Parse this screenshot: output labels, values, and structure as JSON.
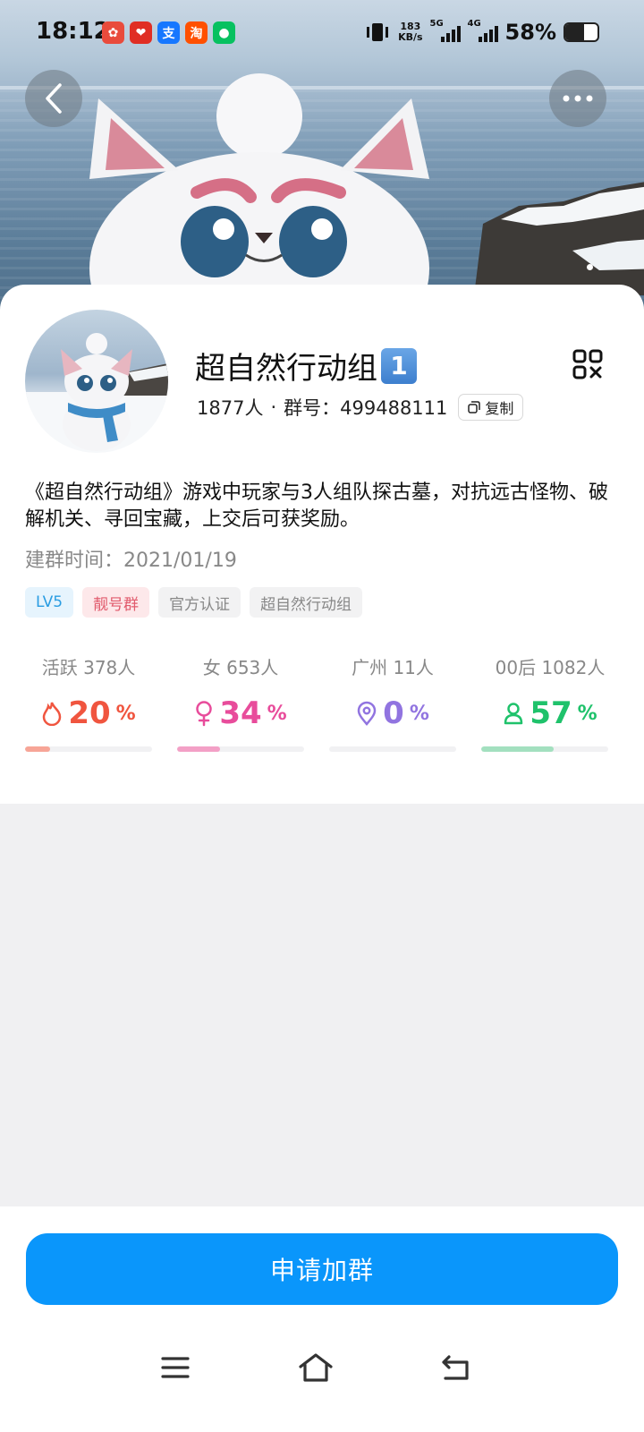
{
  "status_bar": {
    "time": "18:12",
    "net_speed_value": "183",
    "net_speed_unit": "KB/s",
    "signal_1_label": "5G",
    "signal_2_label": "4G",
    "battery_percent": "58%",
    "battery_level": 0.58,
    "app_icons": [
      {
        "name": "baidu-map-icon",
        "glyph": "✿",
        "color": "#e94b3c"
      },
      {
        "name": "pinduoduo-icon",
        "glyph": "❤",
        "color": "#e02e24"
      },
      {
        "name": "alipay-icon",
        "glyph": "支",
        "color": "#1677ff"
      },
      {
        "name": "taobao-icon",
        "glyph": "淘",
        "color": "#ff5000"
      },
      {
        "name": "wechat-icon",
        "glyph": "●",
        "color": "#07c160"
      }
    ]
  },
  "header": {
    "back_icon": "chevron-left-icon",
    "more_icon": "more-horizontal-icon"
  },
  "group": {
    "name": "超自然行动组",
    "name_emoji": "1",
    "member_count": "1877人",
    "separator": "·",
    "group_id_label": "群号：",
    "group_id": "499488111",
    "copy_label": "复制",
    "description": "《超自然行动组》游戏中玩家与3人组队探古墓，对抗远古怪物、破解机关、寻回宝藏，上交后可获奖励。",
    "created_label": "建群时间：",
    "created_date": "2021/01/19",
    "tags": [
      "LV5",
      "靓号群",
      "官方认证",
      "超自然行动组"
    ]
  },
  "stats": [
    {
      "label": "活跃 378人",
      "value": "20",
      "unit": "%",
      "icon": "flame-icon",
      "color": "#f0553f",
      "bar_color": "#f7a597",
      "fraction": 0.2
    },
    {
      "label": "女 653人",
      "value": "34",
      "unit": "%",
      "icon": "female-icon",
      "color": "#e84c9b",
      "bar_color": "#f3a0c6",
      "fraction": 0.34
    },
    {
      "label": "广州 11人",
      "value": "0",
      "unit": "%",
      "icon": "location-pin-icon",
      "color": "#9174e0",
      "bar_color": "#c5b6f0",
      "fraction": 0.0
    },
    {
      "label": "00后 1082人",
      "value": "57",
      "unit": "%",
      "icon": "person-icon",
      "color": "#1fc26b",
      "bar_color": "#a3e0bf",
      "fraction": 0.57
    }
  ],
  "actions": {
    "join_label": "申请加群"
  },
  "nav": {
    "menu_icon": "menu-icon",
    "home_icon": "home-icon",
    "back_icon": "back-icon"
  }
}
